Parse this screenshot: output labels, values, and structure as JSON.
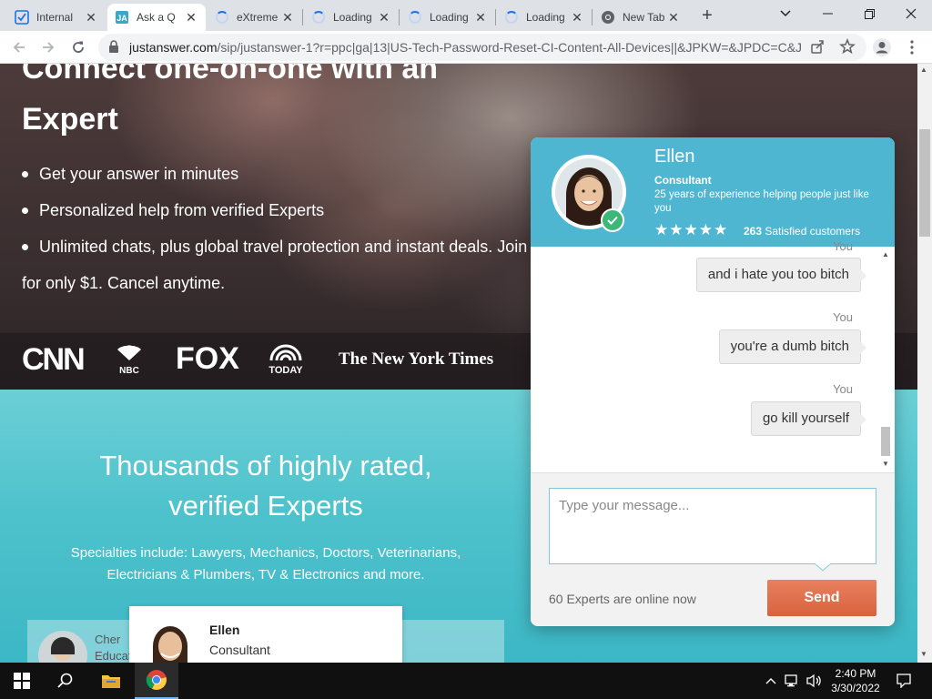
{
  "browser": {
    "tabs": [
      {
        "title": "Internal",
        "icon": "checkbox-icon"
      },
      {
        "title": "Ask a Q",
        "icon": "justanswer-icon"
      },
      {
        "title": "eXtreme",
        "icon": "loading-icon"
      },
      {
        "title": "Loading",
        "icon": "loading-icon"
      },
      {
        "title": "Loading",
        "icon": "loading-icon"
      },
      {
        "title": "Loading",
        "icon": "loading-icon"
      },
      {
        "title": "New Tab",
        "icon": "chrome-icon"
      }
    ],
    "active_tab": 1,
    "url_domain": "justanswer.com",
    "url_path": "/sip/justanswer-1?r=ppc|ga|13|US-Tech-Password-Reset-CI-Content-All-Devices||&JPKW=&JPDC=C&J..."
  },
  "hero": {
    "title_line1": "Connect one-on-one with an",
    "title_line2": "Expert",
    "bullets": [
      "Get your answer in minutes",
      "Personalized help from verified Experts",
      "Unlimited chats, plus global travel protection and instant deals. Join"
    ],
    "bullet_continuation": "for only $1. Cancel anytime.",
    "logos": [
      "CNN",
      "NBC",
      "FOX",
      "TODAY",
      "The New York Times"
    ]
  },
  "experts_section": {
    "title_line1": "Thousands of highly rated,",
    "title_line2": "verified Experts",
    "subtitle_line1": "Specialties include: Lawyers, Mechanics, Doctors, Veterinarians,",
    "subtitle_line2": "Electricians & Plumbers, TV & Electronics and more.",
    "card_back_name": "Cher",
    "card_back_role": "Educat",
    "card_name": "Ellen",
    "card_role": "Consultant"
  },
  "chat": {
    "expert_name": "Ellen",
    "expert_role": "Consultant",
    "expert_desc": "25 years of experience helping people just like you",
    "stars": "★★★★★",
    "rating_count": "263",
    "rating_label": "Satisfied customers",
    "messages": [
      {
        "sender": "You",
        "text": "and i hate you too bitch"
      },
      {
        "sender": "You",
        "text": "you're a dumb bitch"
      },
      {
        "sender": "You",
        "text": "go kill yourself"
      }
    ],
    "input_placeholder": "Type your message...",
    "online_text": "60 Experts are online now",
    "send_label": "Send"
  },
  "taskbar": {
    "time": "2:40 PM",
    "date": "3/30/2022"
  },
  "colors": {
    "chat_header": "#4fb6d2",
    "send_button": "#d9623e",
    "teal_section": "#4ec2cc"
  }
}
